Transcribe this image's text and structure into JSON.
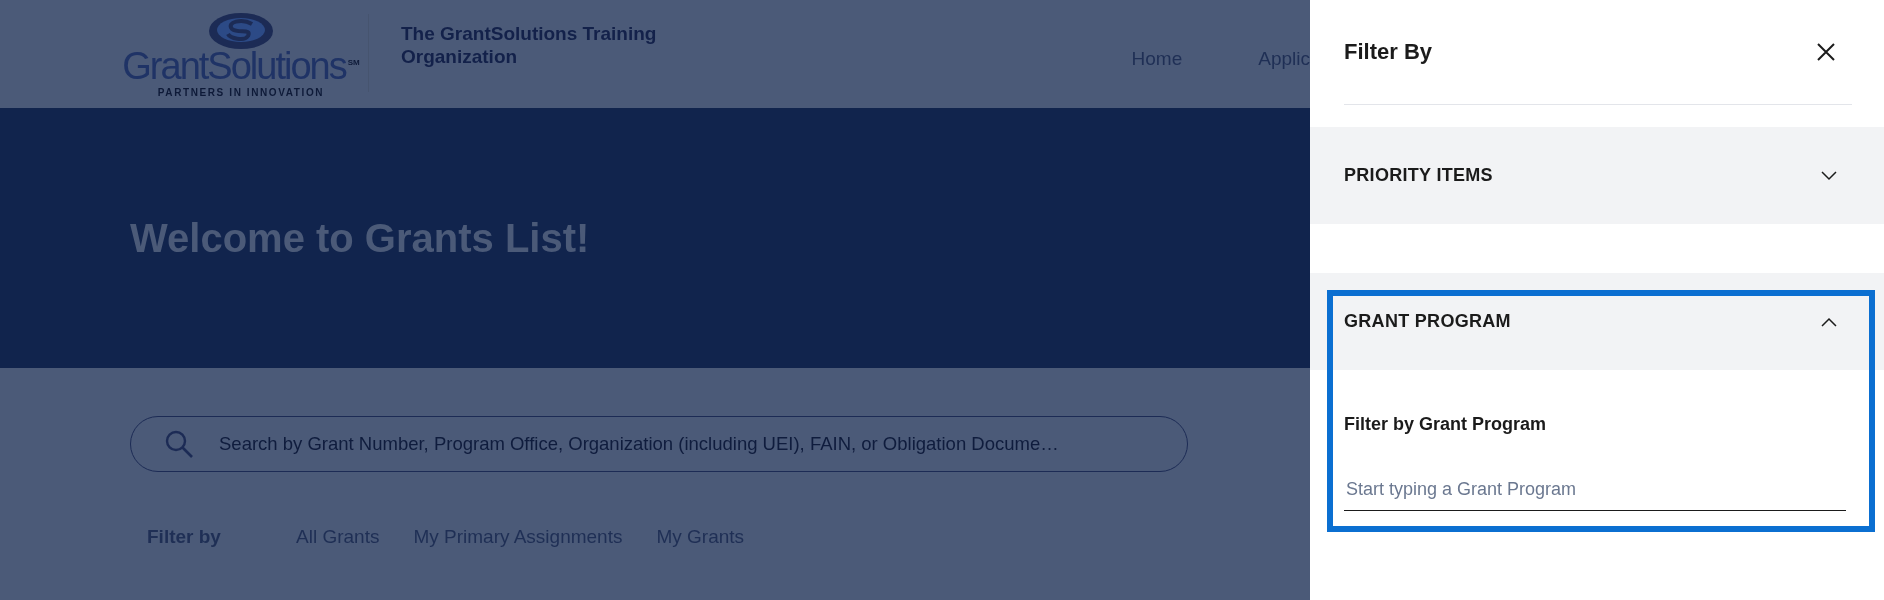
{
  "header": {
    "logo": {
      "wordmark": "GrantSolutions",
      "service_mark": "SM",
      "tagline": "PARTNERS IN INNOVATION"
    },
    "organization": "The GrantSolutions Training Organization",
    "nav": [
      "Home",
      "Applic"
    ]
  },
  "hero": {
    "title": "Welcome to Grants List!"
  },
  "search": {
    "placeholder": "Search by Grant Number, Program Office, Organization (including UEI), FAIN, or Obligation Docume…"
  },
  "filter_bar": {
    "label": "Filter by",
    "options": [
      "All Grants",
      "My Primary Assignments",
      "My Grants"
    ]
  },
  "panel": {
    "title": "Filter By",
    "sections": [
      {
        "title": "PRIORITY ITEMS",
        "expanded": false,
        "focused": false
      },
      {
        "title": "GRANT PROGRAM",
        "expanded": true,
        "focused": true,
        "field_label": "Filter by Grant Program",
        "placeholder": "Start typing a Grant Program"
      }
    ]
  }
}
